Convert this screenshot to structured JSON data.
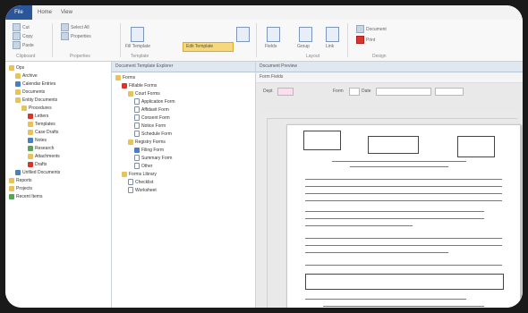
{
  "ribbon": {
    "file_tab": "File",
    "tabs": [
      "Home",
      "View"
    ],
    "groups": [
      {
        "label": "Clipboard",
        "buttons": [
          "Cut",
          "Copy",
          "Paste"
        ]
      },
      {
        "label": "Properties",
        "buttons": [
          "Select All",
          "Properties"
        ]
      },
      {
        "label": "Template",
        "buttons": [
          "Fill Template"
        ]
      },
      {
        "label": "Layout",
        "buttons": [
          "Fields",
          "Group",
          "Link"
        ]
      },
      {
        "label": "Design",
        "buttons": [
          "Document",
          "Print"
        ]
      }
    ],
    "highlighted_button": "Edit Template"
  },
  "left_pane": {
    "items": [
      {
        "label": "Ops",
        "icon": "folder-icon",
        "indent": 0
      },
      {
        "label": "Archive",
        "icon": "folder-icon",
        "indent": 1
      },
      {
        "label": "Calendar Entries",
        "icon": "blue-icon",
        "indent": 1
      },
      {
        "label": "Documents",
        "icon": "folder-icon",
        "indent": 1
      },
      {
        "label": "Entity Documents",
        "icon": "folder-icon",
        "indent": 1
      },
      {
        "label": "Procedures",
        "icon": "folder-icon",
        "indent": 2
      },
      {
        "label": "Letters",
        "icon": "red-icon",
        "indent": 3
      },
      {
        "label": "Templates",
        "icon": "folder-icon",
        "indent": 3
      },
      {
        "label": "Case Drafts",
        "icon": "folder-icon",
        "indent": 3
      },
      {
        "label": "Notes",
        "icon": "blue-icon",
        "indent": 3
      },
      {
        "label": "Research",
        "icon": "green-icon",
        "indent": 3
      },
      {
        "label": "Attachments",
        "icon": "folder-icon",
        "indent": 3
      },
      {
        "label": "Drafts",
        "icon": "red-icon",
        "indent": 3
      },
      {
        "label": "Unfiled Documents",
        "icon": "blue-icon",
        "indent": 1
      },
      {
        "label": "Reports",
        "icon": "folder-icon",
        "indent": 0
      },
      {
        "label": "Projects",
        "icon": "folder-icon",
        "indent": 0
      },
      {
        "label": "Recent Items",
        "icon": "green-icon",
        "indent": 0
      }
    ]
  },
  "middle_pane": {
    "header": "Document Template Explorer",
    "items": [
      {
        "label": "Forms",
        "icon": "folder-icon",
        "indent": 0
      },
      {
        "label": "Fillable Forms",
        "icon": "red-icon",
        "indent": 1
      },
      {
        "label": "Court Forms",
        "icon": "folder-icon",
        "indent": 2
      },
      {
        "label": "Application Form",
        "icon": "doc-icon",
        "indent": 3
      },
      {
        "label": "Affidavit Form",
        "icon": "doc-icon",
        "indent": 3
      },
      {
        "label": "Consent Form",
        "icon": "doc-icon",
        "indent": 3
      },
      {
        "label": "Notice Form",
        "icon": "doc-icon",
        "indent": 3
      },
      {
        "label": "Schedule Form",
        "icon": "doc-icon",
        "indent": 3
      },
      {
        "label": "Registry Forms",
        "icon": "folder-icon",
        "indent": 2
      },
      {
        "label": "Filing Form",
        "icon": "blue-icon",
        "indent": 3
      },
      {
        "label": "Summary Form",
        "icon": "doc-icon",
        "indent": 3
      },
      {
        "label": "Other",
        "icon": "doc-icon",
        "indent": 3
      },
      {
        "label": "Forms Library",
        "icon": "folder-icon",
        "indent": 1
      },
      {
        "label": "Checklist",
        "icon": "doc-icon",
        "indent": 2
      },
      {
        "label": "Worksheet",
        "icon": "doc-icon",
        "indent": 2
      }
    ]
  },
  "doc_pane": {
    "title_bar": "Document Preview",
    "toolbar_text": "Form Fields",
    "fields": [
      "Dept",
      "Form",
      "Date"
    ]
  }
}
